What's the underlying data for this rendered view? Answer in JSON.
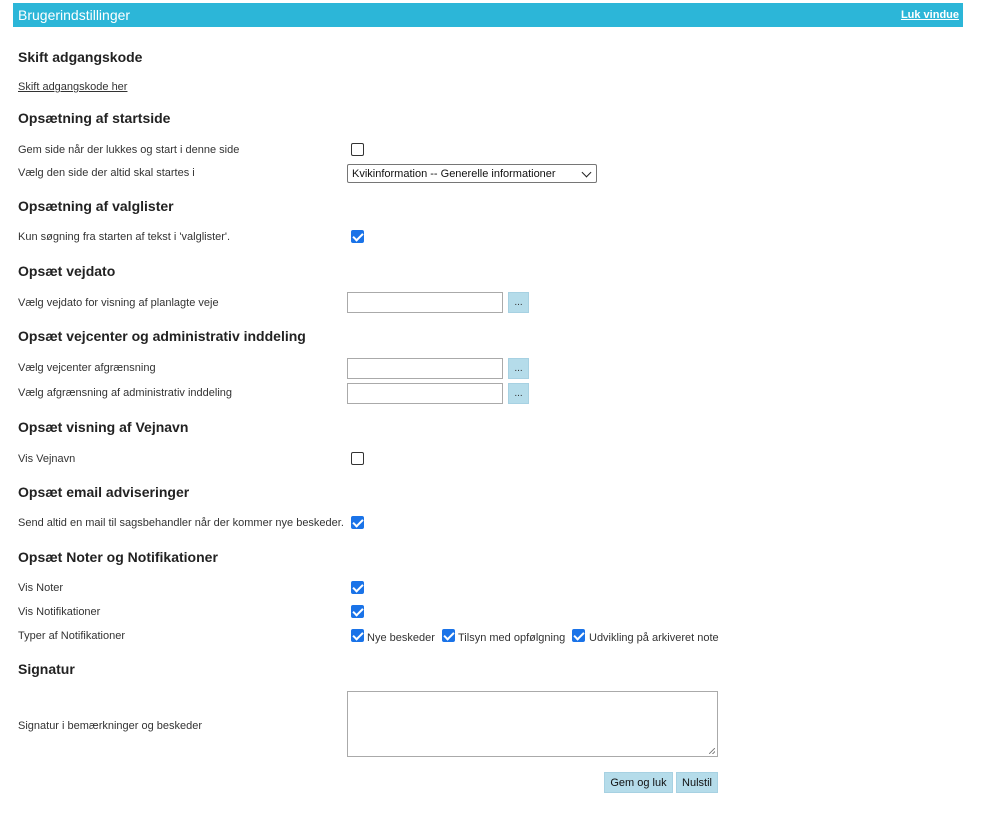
{
  "window": {
    "title": "Brugerindstillinger",
    "close_label": "Luk vindue"
  },
  "password": {
    "heading": "Skift adgangskode",
    "link": "Skift adgangskode her"
  },
  "startpage": {
    "heading": "Opsætning af startside",
    "save_label": "Gem side når der lukkes og start i denne side",
    "save_checked": false,
    "choose_label": "Vælg den side der altid skal startes i",
    "choose_value": "Kvikinformation -- Generelle informationer"
  },
  "picklists": {
    "heading": "Opsætning af valglister",
    "search_label": "Kun søgning fra starten af tekst i 'valglister'.",
    "search_checked": true
  },
  "roaddate": {
    "heading": "Opsæt vejdato",
    "label": "Vælg vejdato for visning af planlagte veje",
    "value": "",
    "button": "..."
  },
  "roadcenter": {
    "heading": "Opsæt vejcenter og administrativ inddeling",
    "center_label": "Vælg vejcenter afgrænsning",
    "center_value": "",
    "admin_label": "Vælg afgrænsning af administrativ inddeling",
    "admin_value": "",
    "button": "..."
  },
  "roadnames": {
    "heading": "Opsæt visning af Vejnavn",
    "label": "Vis Vejnavn",
    "checked": false
  },
  "email": {
    "heading": "Opsæt email adviseringer",
    "label": "Send altid en mail til sagsbehandler når der kommer nye beskeder.",
    "checked": true
  },
  "notes": {
    "heading": "Opsæt Noter og Notifikationer",
    "show_notes_label": "Vis Noter",
    "show_notes_checked": true,
    "show_notifications_label": "Vis Notifikationer",
    "show_notifications_checked": true,
    "types_label": "Typer af Notifikationer",
    "types": [
      {
        "label": "Nye beskeder",
        "checked": true
      },
      {
        "label": "Tilsyn med opfølgning",
        "checked": true
      },
      {
        "label": "Udvikling på arkiveret note",
        "checked": true
      }
    ]
  },
  "signature": {
    "heading": "Signatur",
    "label": "Signatur i bemærkninger og beskeder",
    "value": ""
  },
  "actions": {
    "save_close": "Gem og luk",
    "reset": "Nulstil"
  },
  "colors": {
    "titlebar": "#2cb6d8",
    "button": "#b5dcea",
    "checkbox": "#1a73e8"
  }
}
